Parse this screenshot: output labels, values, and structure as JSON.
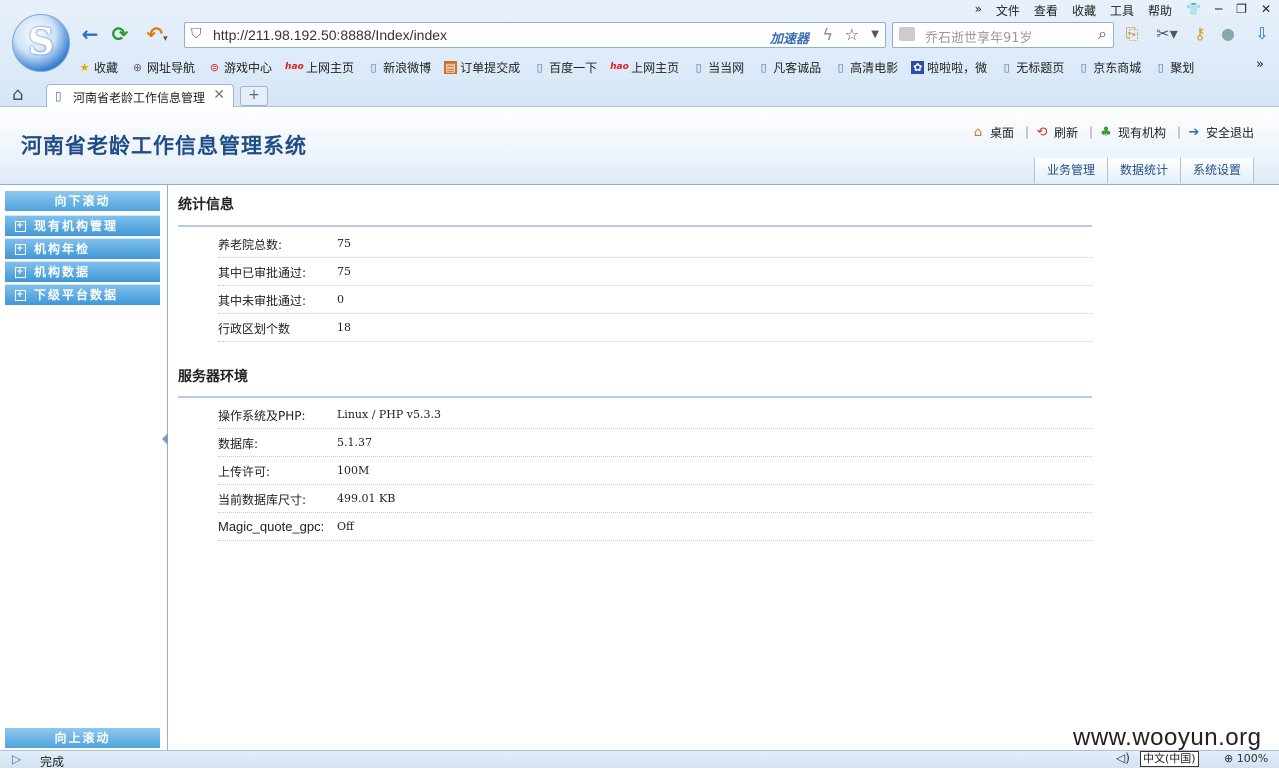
{
  "browser": {
    "menu": [
      "文件",
      "查看",
      "收藏",
      "工具",
      "帮助"
    ],
    "menu_more": "»",
    "address": "http://211.98.192.50:8888/Index/index",
    "accelerator": "加速器",
    "search_placeholder": "乔石逝世享年91岁",
    "favorites": [
      {
        "label": "收藏",
        "icon": "star-icon"
      },
      {
        "label": "网址导航",
        "icon": "globe-icon"
      },
      {
        "label": "游戏中心",
        "icon": "game-icon"
      },
      {
        "label": "上网主页",
        "icon": "hao-icon"
      },
      {
        "label": "新浪微博",
        "icon": "page-icon"
      },
      {
        "label": "订单提交成",
        "icon": "order-icon"
      },
      {
        "label": "百度一下",
        "icon": "page-icon"
      },
      {
        "label": "上网主页",
        "icon": "hao-icon"
      },
      {
        "label": "当当网",
        "icon": "page-icon"
      },
      {
        "label": "凡客诚品",
        "icon": "page-icon"
      },
      {
        "label": "高清电影",
        "icon": "page-icon"
      },
      {
        "label": "啦啦啦，微",
        "icon": "paw-icon"
      },
      {
        "label": "无标题页",
        "icon": "page-icon"
      },
      {
        "label": "京东商城",
        "icon": "page-icon"
      },
      {
        "label": "聚划",
        "icon": "page-icon"
      }
    ],
    "favorites_more": "»",
    "tab_title": "河南省老龄工作信息管理",
    "new_tab": "+"
  },
  "header": {
    "title": "河南省老龄工作信息管理系统",
    "links": [
      "桌面",
      "刷新",
      "现有机构",
      "安全退出"
    ],
    "nav_tabs": [
      "业务管理",
      "数据统计",
      "系统设置"
    ]
  },
  "sidebar": {
    "scroll_down": "向下滚动",
    "scroll_up": "向上滚动",
    "items": [
      "现有机构管理",
      "机构年检",
      "机构数据",
      "下级平台数据"
    ]
  },
  "stats": {
    "title": "统计信息",
    "rows": [
      {
        "label": "养老院总数:",
        "value": "75"
      },
      {
        "label": "其中已审批通过:",
        "value": "75"
      },
      {
        "label": "其中未审批通过:",
        "value": "0"
      },
      {
        "label": "行政区划个数",
        "value": "18"
      }
    ]
  },
  "server": {
    "title": "服务器环境",
    "rows": [
      {
        "label": "操作系统及PHP:",
        "value": "Linux / PHP v5.3.3"
      },
      {
        "label": "数据库:",
        "value": "5.1.37"
      },
      {
        "label": "上传许可:",
        "value": "100M"
      },
      {
        "label": "当前数据库尺寸:",
        "value": "499.01 KB"
      },
      {
        "label": "Magic_quote_gpc:",
        "value": "Off"
      }
    ]
  },
  "statusbar": {
    "status": "完成",
    "ime": "中文(中国)",
    "zoom": "100%"
  },
  "watermark": "www.wooyun.org",
  "colors": {
    "accent": "#1f4e86",
    "sidebar": "#3f97d6"
  }
}
